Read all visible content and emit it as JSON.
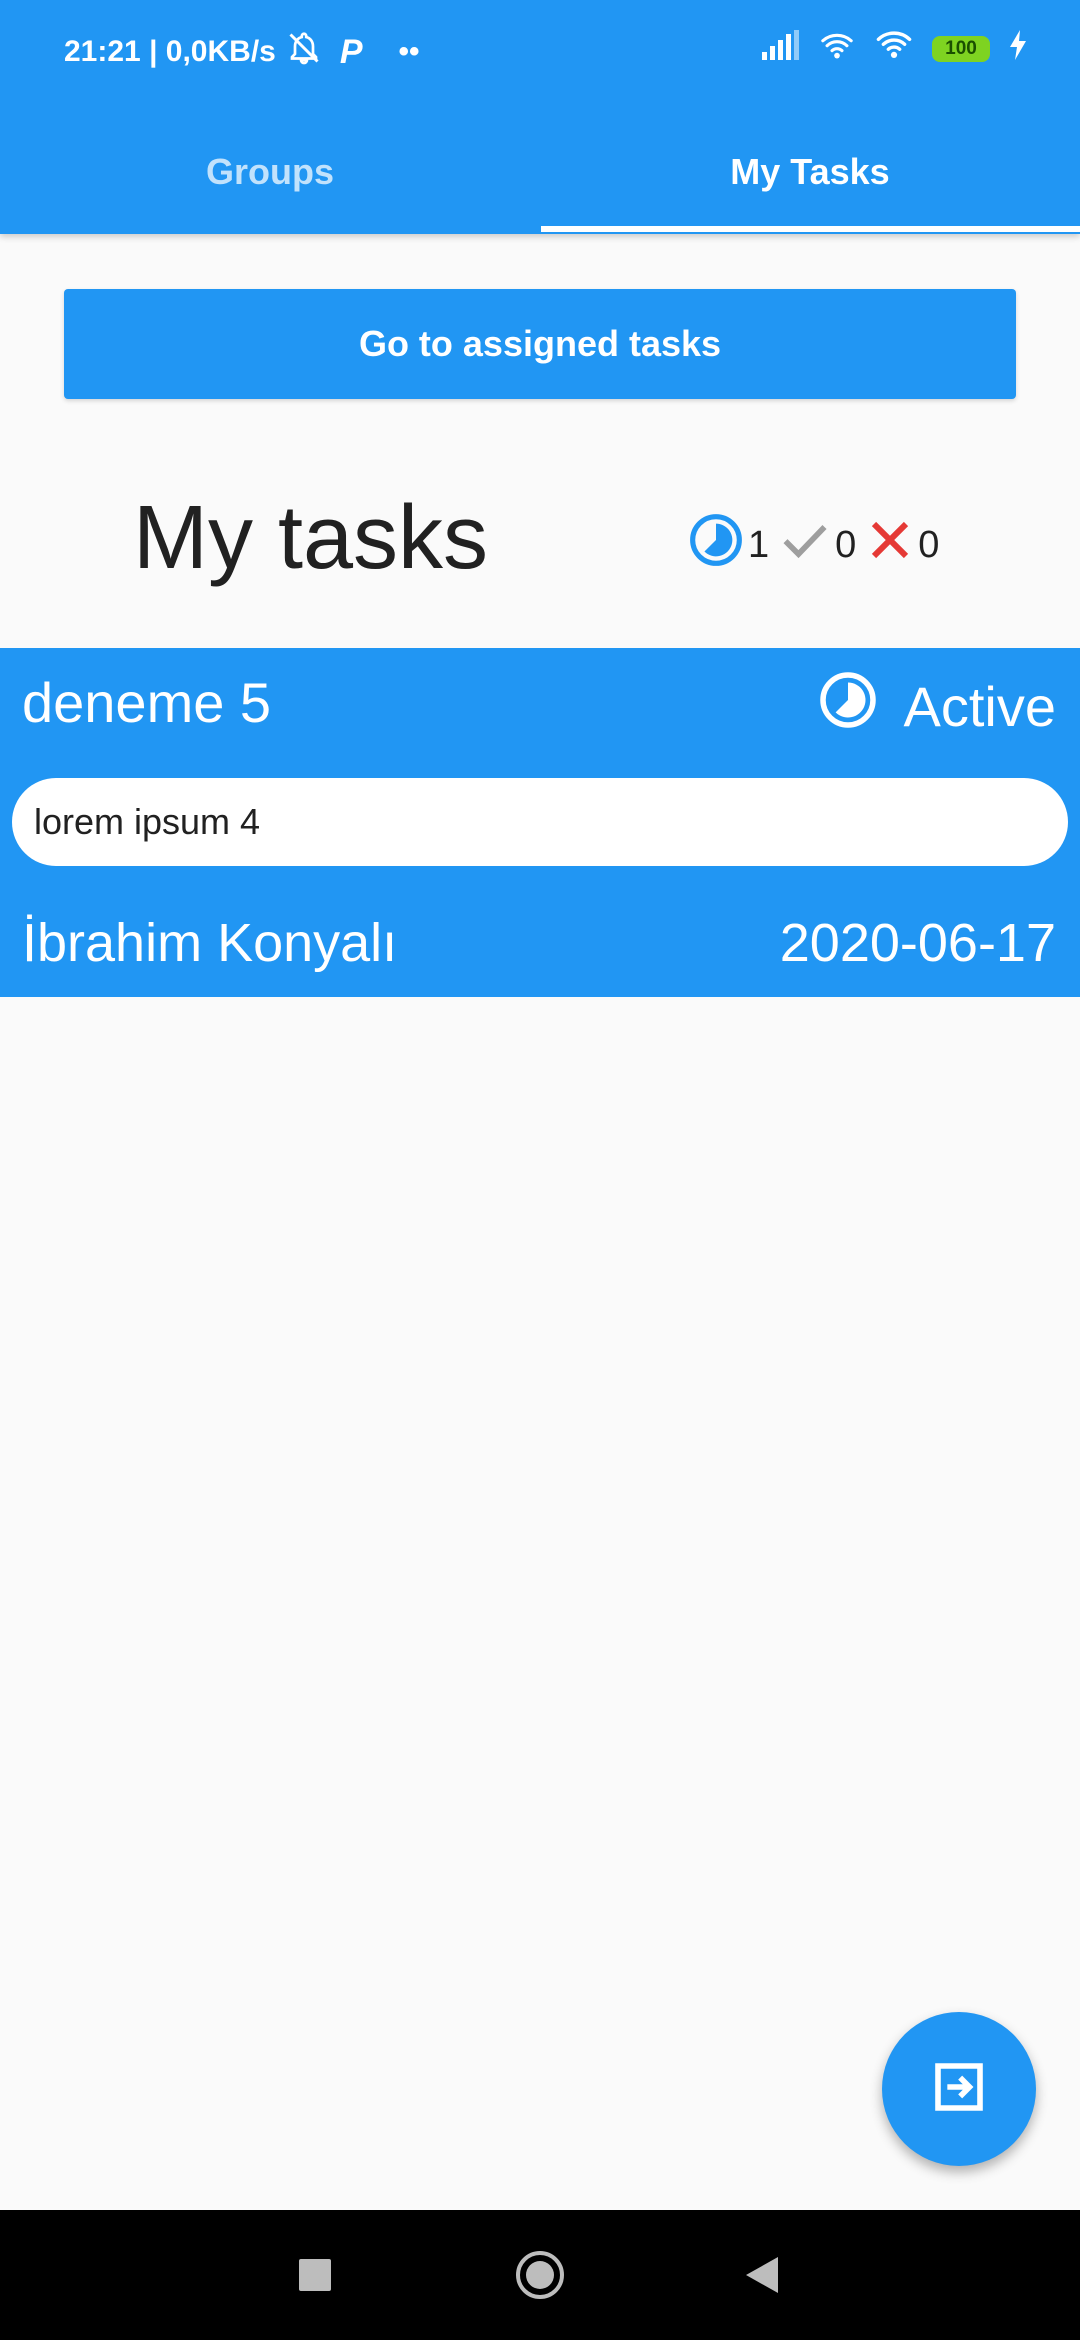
{
  "status_bar": {
    "time_speed": "21:21 | 0,0KB/s",
    "dots": "••",
    "battery": "100"
  },
  "tabs": [
    {
      "label": "Groups",
      "active": false
    },
    {
      "label": "My Tasks",
      "active": true
    }
  ],
  "assigned_button_label": "Go to assigned tasks",
  "section_title": "My tasks",
  "counters": {
    "active": "1",
    "done": "0",
    "failed": "0"
  },
  "task": {
    "title": "deneme 5",
    "status": "Active",
    "description": "lorem ipsum 4",
    "assignee": "İbrahim Konyalı",
    "date": "2020-06-17"
  },
  "colors": {
    "primary": "#2196f3",
    "done": "#9e9e9e",
    "failed": "#e53935",
    "battery": "#7ed321"
  },
  "icons": {
    "fab": "exit-to-app-icon",
    "active": "timelapse-icon",
    "done": "check-icon",
    "failed": "close-icon"
  }
}
